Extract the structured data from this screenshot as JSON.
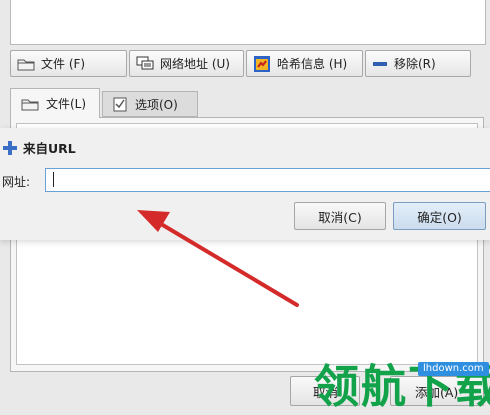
{
  "toolbar": {
    "file_label": "文件 (F)",
    "url_label": "网络地址 (U)",
    "hash_label": "哈希信息 (H)",
    "remove_label": "移除(R)"
  },
  "tabs": [
    {
      "label": "文件(L)"
    },
    {
      "label": "选项(O)"
    }
  ],
  "dialog": {
    "title": "来自URL",
    "url_label": "网址:",
    "url_value": "",
    "cancel_label": "取消(C)",
    "ok_label": "确定(O)"
  },
  "bottom": {
    "left_label": "取消",
    "add_label": "添加(A)"
  },
  "watermark": {
    "text": "领航下载",
    "site": "lhdown.com"
  },
  "colors": {
    "arrow": "#d42a2a",
    "watermark": "#11a24a",
    "focus_border": "#6aa0d8"
  }
}
